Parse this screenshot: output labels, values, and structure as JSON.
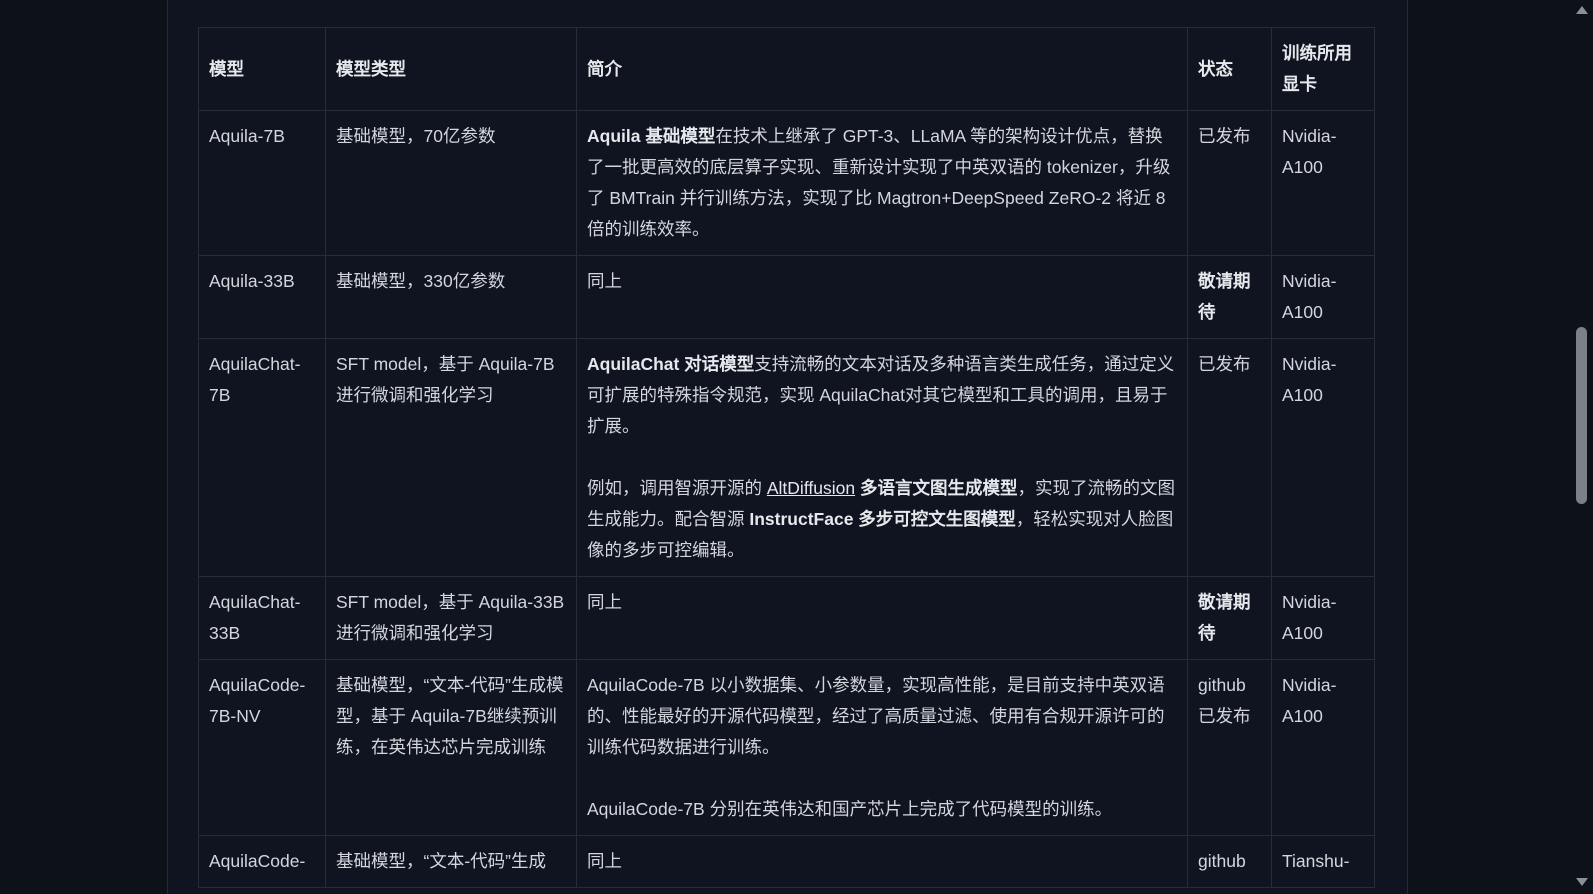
{
  "table": {
    "headers": [
      "模型",
      "模型类型",
      "简介",
      "状态",
      "训练所用显卡"
    ],
    "rows": [
      {
        "model": "Aquila-7B",
        "type": "基础模型，70亿参数",
        "intro_bold": "Aquila 基础模型",
        "intro_text": "在技术上继承了 GPT-3、LLaMA 等的架构设计优点，替换了一批更高效的底层算子实现、重新设计实现了中英双语的 tokenizer，升级了 BMTrain 并行训练方法，实现了比 Magtron+DeepSpeed ZeRO-2 将近 8 倍的训练效率。",
        "status": "已发布",
        "gpu": "Nvidia-A100"
      },
      {
        "model": "Aquila-33B",
        "type": "基础模型，330亿参数",
        "intro_text": "同上",
        "status": "敬请期待",
        "gpu": "Nvidia-A100"
      },
      {
        "model": "AquilaChat-7B",
        "type": "SFT model，基于 Aquila-7B 进行微调和强化学习",
        "intro_bold": "AquilaChat 对话模型",
        "intro_text": "支持流畅的文本对话及多种语言类生成任务，通过定义可扩展的特殊指令规范，实现 AquilaChat对其它模型和工具的调用，且易于扩展。",
        "intro_p2_a": "例如，调用智源开源的 ",
        "intro_p2_link": "AltDiffusion",
        "intro_p2_bold1": " 多语言文图生成模型",
        "intro_p2_b": "，实现了流畅的文图生成能力。配合智源 ",
        "intro_p2_bold2": "InstructFace 多步可控文生图模型",
        "intro_p2_c": "，轻松实现对人脸图像的多步可控编辑。",
        "status": "已发布",
        "gpu": "Nvidia-A100"
      },
      {
        "model": "AquilaChat-33B",
        "type": "SFT model，基于 Aquila-33B 进行微调和强化学习",
        "intro_text": "同上",
        "status": "敬请期待",
        "gpu": "Nvidia-A100"
      },
      {
        "model": "AquilaCode-7B-NV",
        "type": "基础模型，“文本-代码”生成模型，基于 Aquila-7B继续预训练，在英伟达芯片完成训练",
        "intro_text": "AquilaCode-7B 以小数据集、小参数量，实现高性能，是目前支持中英双语的、性能最好的开源代码模型，经过了高质量过滤、使用有合规开源许可的训练代码数据进行训练。",
        "intro_p2": "AquilaCode-7B 分别在英伟达和国产芯片上完成了代码模型的训练。",
        "status": "github 已发布",
        "gpu": "Nvidia-A100"
      },
      {
        "model": "AquilaCode-",
        "type": "基础模型，“文本-代码”生成",
        "intro_text": "同上",
        "status": "github",
        "gpu": "Tianshu-"
      }
    ]
  }
}
